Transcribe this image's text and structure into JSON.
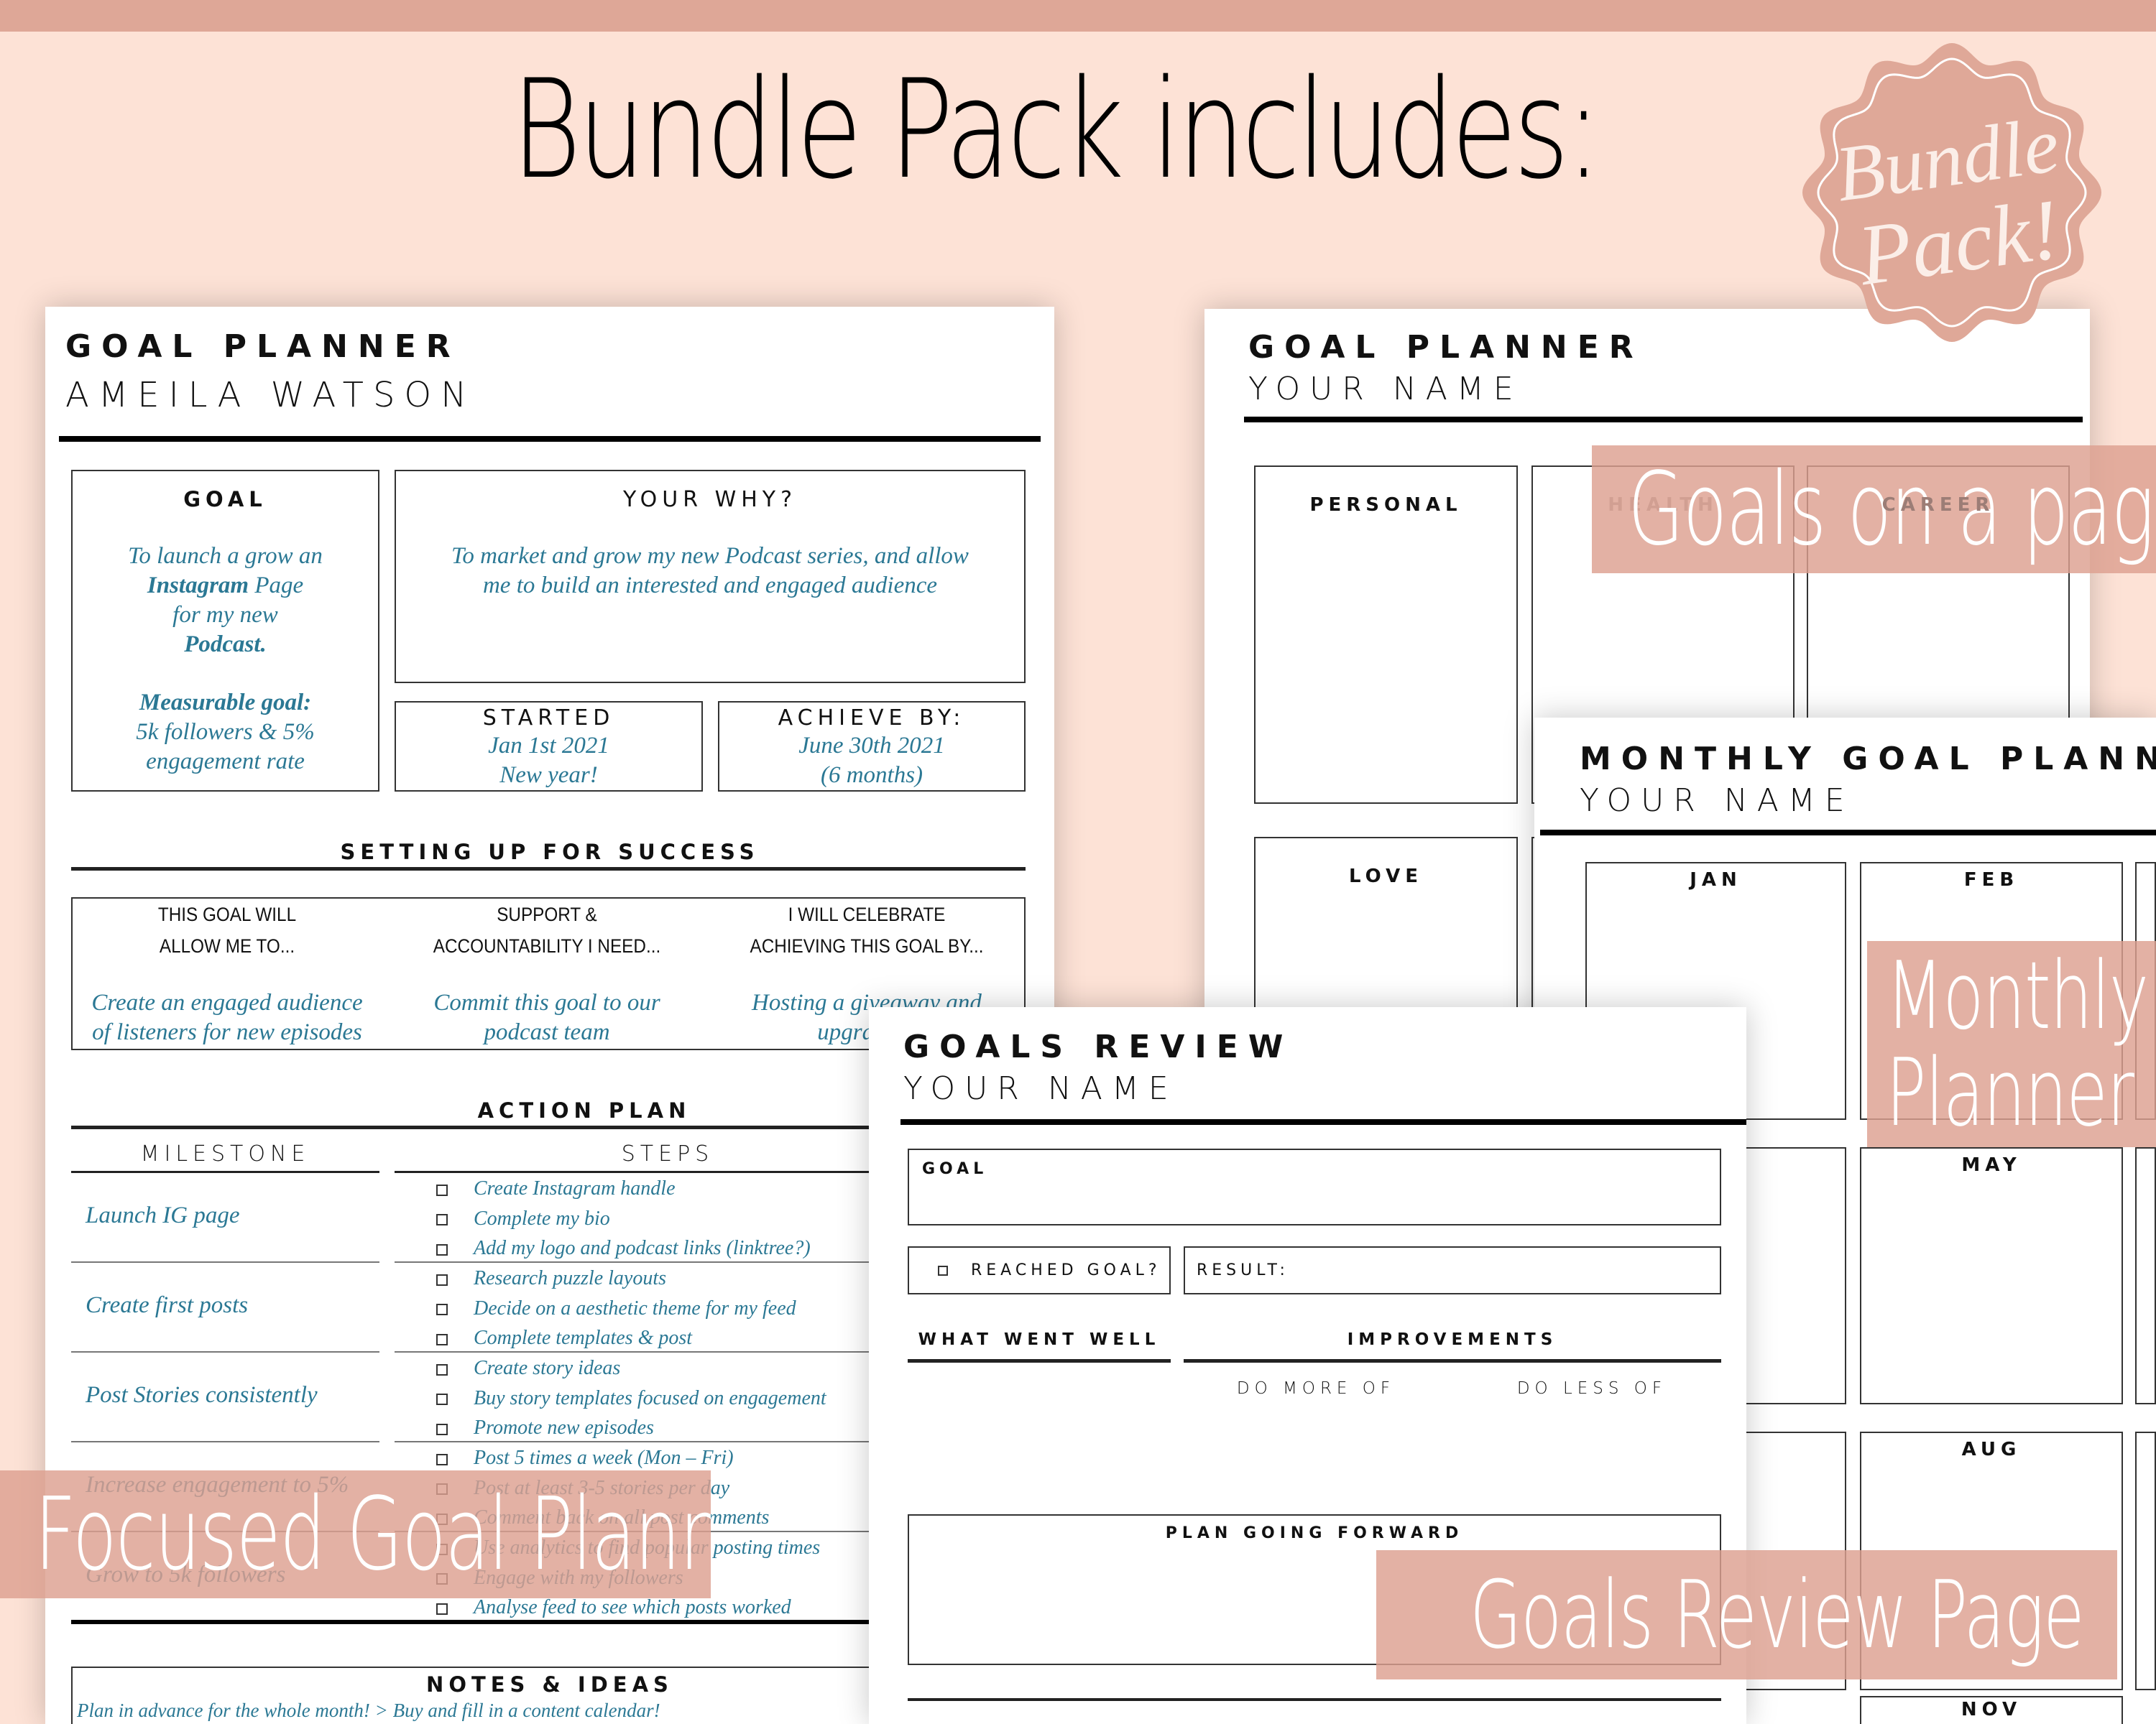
{
  "header": {
    "title": "Bundle Pack includes:"
  },
  "badge": {
    "text_line1": "Bundle",
    "text_line2": "Pack!",
    "color": "#dfa898"
  },
  "colors": {
    "background": "#fde2d6",
    "accent": "#dea797",
    "handwriting": "#2b7894"
  },
  "focused": {
    "title": "GOAL PLANNER",
    "name": "AMEILA WATSON",
    "goal": {
      "label": "GOAL",
      "text1": "To launch a grow an",
      "text2a": "Instagram",
      "text2b": " Page",
      "text3": "for my new",
      "text4": "Podcast.",
      "text5": "Measurable goal:",
      "text6": "5k followers & 5%",
      "text7": "engagement rate"
    },
    "why": {
      "label": "YOUR WHY?",
      "text1": "To market and grow my new Podcast series, and allow",
      "text2": "me to build an interested and engaged audience"
    },
    "started": {
      "label": "STARTED",
      "text1": "Jan 1st 2021",
      "text2": "New year!"
    },
    "achieve": {
      "label": "ACHIEVE BY:",
      "text1": "June 30th 2021",
      "text2": "(6 months)"
    },
    "success": {
      "heading": "SETTING UP FOR SUCCESS",
      "cols": [
        {
          "q1": "THIS GOAL WILL",
          "q2": "ALLOW ME TO...",
          "a1": "Create an engaged audience",
          "a2": "of listeners for new episodes"
        },
        {
          "q1": "SUPPORT &",
          "q2": "ACCOUNTABILITY I NEED...",
          "a1": "Commit this goal to our",
          "a2": "podcast team"
        },
        {
          "q1": "I WILL CELEBRATE",
          "q2": "ACHIEVING THIS GOAL BY...",
          "a1": "Hosting a giveaway and",
          "a2": "upgrading"
        }
      ]
    },
    "action": {
      "heading": "ACTION PLAN",
      "milestone_header": "MILESTONE",
      "steps_header": "STEPS",
      "rows": [
        {
          "milestone": "Launch IG page",
          "steps": [
            "Create Instagram handle",
            "Complete my bio",
            "Add my logo and podcast links (linktree?)"
          ]
        },
        {
          "milestone": "Create first posts",
          "steps": [
            "Research puzzle layouts",
            "Decide on a aesthetic theme for my feed",
            "Complete templates & post"
          ]
        },
        {
          "milestone": "Post Stories consistently",
          "steps": [
            "Create story ideas",
            "Buy story templates focused on engagement",
            "Promote new episodes"
          ]
        },
        {
          "milestone": "Increase engagement to 5%",
          "steps": [
            "Post 5 times a week (Mon – Fri)",
            "Post at least 3-5 stories per day",
            "Comment back on all post comments"
          ]
        },
        {
          "milestone": "Grow to 5k followers",
          "steps": [
            "Use analytics to find popular posting times",
            "Engage with my followers",
            "Analyse feed to see which posts worked"
          ]
        }
      ]
    },
    "notes": {
      "heading": "NOTES & IDEAS",
      "text": "Plan in advance for the whole month! > Buy and fill in a content calendar!"
    }
  },
  "goals_page": {
    "title": "GOAL PLANNER",
    "name": "YOUR NAME",
    "categories": [
      "PERSONAL",
      "HEALTH",
      "CAREER",
      "LOVE"
    ]
  },
  "monthly": {
    "title": "MONTHLY GOAL PLANNER",
    "name": "YOUR NAME",
    "months": {
      "jan": "JAN",
      "feb": "FEB",
      "may": "MAY",
      "aug": "AUG",
      "nov": "NOV"
    }
  },
  "review": {
    "title": "GOALS REVIEW",
    "name": "YOUR NAME",
    "goal_label": "GOAL",
    "reached_label": "REACHED GOAL?",
    "result_label": "RESULT:",
    "went_well": "WHAT WENT WELL",
    "improvements": "IMPROVEMENTS",
    "do_more": "DO MORE OF",
    "do_less": "DO LESS OF",
    "plan": "PLAN GOING FORWARD"
  },
  "labels": {
    "goals_on_page": "Goals on a page",
    "monthly": "Monthly",
    "planner": "Planner",
    "focused": "Focused Goal Planner",
    "review": "Goals Review Page"
  }
}
